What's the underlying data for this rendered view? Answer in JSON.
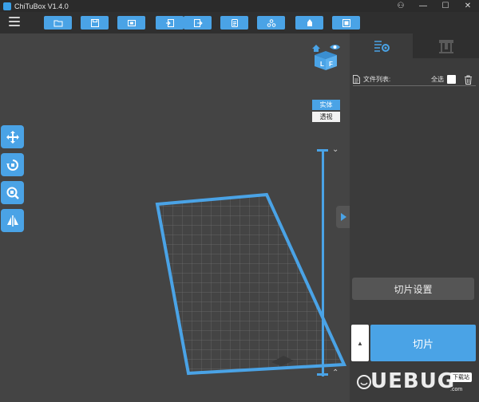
{
  "window": {
    "title": "ChiTuBox V1.4.0",
    "controls": {
      "account": "⚇",
      "minimize": "—",
      "maximize": "☐",
      "close": "✕"
    }
  },
  "toolbar": {
    "buttons": [
      {
        "id": "open",
        "icon": "folder-icon"
      },
      {
        "id": "save",
        "icon": "save-icon"
      },
      {
        "id": "screenshot",
        "icon": "screenshot-icon"
      },
      {
        "id": "import",
        "icon": "import-icon"
      },
      {
        "id": "export",
        "icon": "export-icon"
      },
      {
        "id": "notes",
        "icon": "notes-icon"
      },
      {
        "id": "support",
        "icon": "support-icon"
      },
      {
        "id": "hollow",
        "icon": "hollow-icon"
      },
      {
        "id": "frame",
        "icon": "frame-icon"
      }
    ]
  },
  "viewport": {
    "cube_faces": {
      "left": "L",
      "front": "F"
    },
    "mode_solid": "实体",
    "mode_xray": "透视",
    "arrow_down": "⌄",
    "arrow_up": "⌃"
  },
  "panel": {
    "file_list_label": "文件列表:",
    "select_all": "全选",
    "slice_settings": "切片设置",
    "slice": "切片",
    "expand_arrow": "▲"
  },
  "watermark": {
    "brand": "UEBUG",
    "badge": "下载站",
    "domain": ".com"
  },
  "colors": {
    "accent": "#4aa3e6",
    "background": "#444444",
    "panel": "#3b3b3b"
  }
}
